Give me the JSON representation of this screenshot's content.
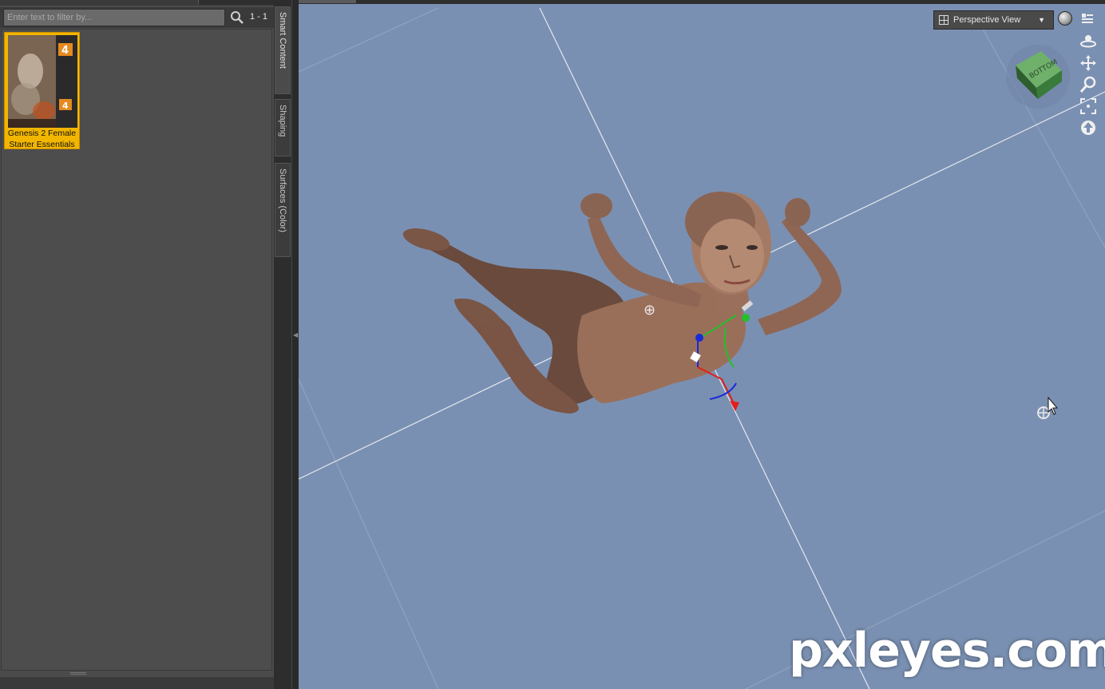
{
  "content_library": {
    "filter_placeholder": "Enter text to filter by...",
    "result_count": "1 - 1",
    "products": [
      {
        "name": "Genesis 2 Female Starter Essentials"
      }
    ]
  },
  "side_tabs": [
    {
      "label": "Smart Content",
      "active": true
    },
    {
      "label": "Shaping",
      "active": false
    },
    {
      "label": "Surfaces (Color)",
      "active": false
    }
  ],
  "viewport": {
    "view_mode": "Perspective View",
    "background_color": "#7a90b2",
    "nav_cube_color": "#4e8f4e",
    "nav_tools": [
      "orbit-icon",
      "pan-icon",
      "zoom-icon",
      "frame-icon",
      "home-icon"
    ],
    "gizmo_axis_colors": {
      "x": "#e0201c",
      "y": "#22c02a",
      "z": "#1a2ad8"
    }
  },
  "watermark": "pxleyes.com",
  "colors": {
    "panel_bg": "#4b4b4b",
    "selection": "#f2b600",
    "text": "#e6e6e6"
  }
}
